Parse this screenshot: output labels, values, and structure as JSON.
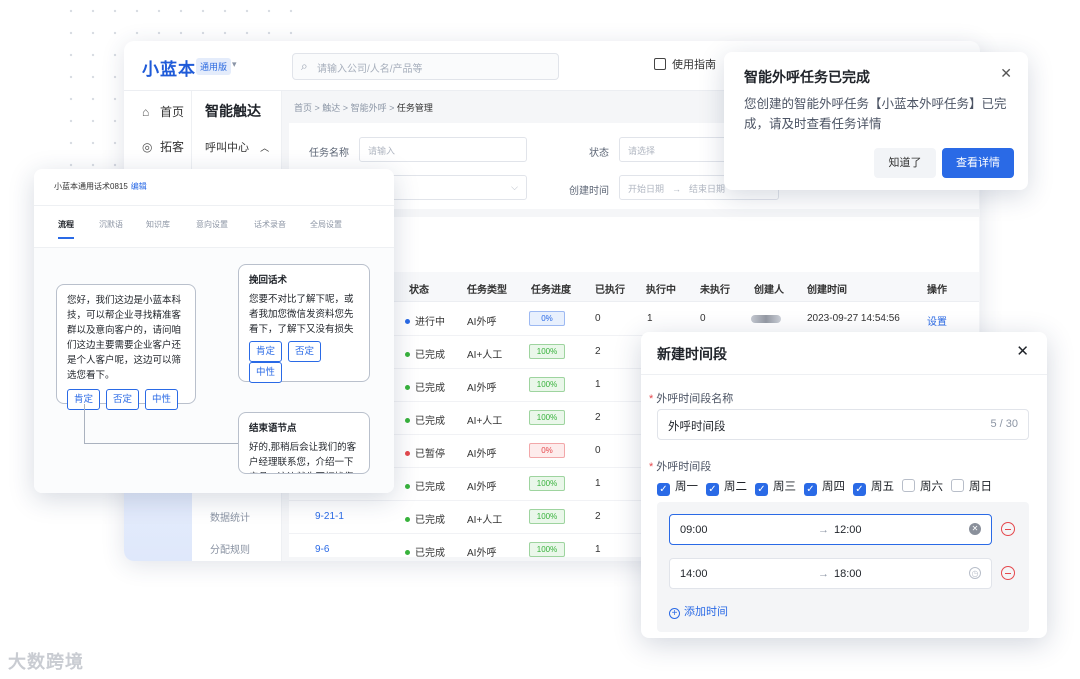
{
  "app": {
    "logo": "小蓝本",
    "edition": "通用版",
    "search_placeholder": "请输入公司/人名/产品等",
    "guide": "使用指南",
    "nav": {
      "home": "首页",
      "prospect": "拓客"
    },
    "subnav": {
      "title": "智能触达",
      "group": "呼叫中心",
      "lower1": "数据统计",
      "lower2": "分配规则"
    },
    "breadcrumb": [
      "首页",
      "触达",
      "智能外呼",
      "任务管理"
    ],
    "filters": {
      "task_name_label": "任务名称",
      "task_name_placeholder": "请输入",
      "status_label": "状态",
      "status_placeholder": "请选择",
      "created_label": "创建时间",
      "start_placeholder": "开始日期",
      "end_placeholder": "结束日期"
    },
    "table": {
      "headers": [
        "状态",
        "任务类型",
        "任务进度",
        "已执行",
        "执行中",
        "未执行",
        "创建人",
        "创建时间",
        "操作"
      ],
      "rows": [
        {
          "status": "进行中",
          "status_color": "#2a6ae6",
          "type": "AI外呼",
          "progress": "0%",
          "progress_kind": "blue",
          "done": "0",
          "running": "1",
          "pending": "0",
          "created": "2023-09-27 14:54:56",
          "action": "设置"
        },
        {
          "status": "已完成",
          "status_color": "#38b23c",
          "type": "AI+人工",
          "progress": "100%",
          "progress_kind": "green",
          "done": "2"
        },
        {
          "status": "已完成",
          "status_color": "#38b23c",
          "type": "AI外呼",
          "progress": "100%",
          "progress_kind": "green",
          "done": "1"
        },
        {
          "status": "已完成",
          "status_color": "#38b23c",
          "type": "AI+人工",
          "progress": "100%",
          "progress_kind": "green",
          "done": "2"
        },
        {
          "status": "已暂停",
          "status_color": "#e5484d",
          "type": "AI外呼",
          "progress": "0%",
          "progress_kind": "red",
          "done": "0"
        },
        {
          "status": "已完成",
          "status_color": "#38b23c",
          "type": "AI外呼",
          "progress": "100%",
          "progress_kind": "green",
          "done": "1"
        },
        {
          "status": "已完成",
          "status_color": "#38b23c",
          "type": "AI+人工",
          "progress": "100%",
          "progress_kind": "green",
          "done": "2",
          "name": "9-21-1"
        },
        {
          "status": "已完成",
          "status_color": "#38b23c",
          "type": "AI外呼",
          "progress": "100%",
          "progress_kind": "green",
          "done": "1",
          "name": "9-6"
        }
      ]
    }
  },
  "script_editor": {
    "title": "小蓝本通用话术0815",
    "edit": "编辑",
    "tabs": [
      "流程",
      "沉默语",
      "知识库",
      "意向设置",
      "话术录音",
      "全局设置"
    ],
    "node_main": "您好，我们这边是小蓝本科技，可以帮企业寻找精准客群以及意向客户的，请问咱们这边主要需要企业客户还是个人客户呢，这边可以筛选您看下。",
    "node_recover_title": "挽回话术",
    "node_recover_text": "您要不对比了解下呢，或者我加您微信发资料您先看下，了解下又没有损失的嘛",
    "node_end_title": "结束语节点",
    "node_end_text": "好的,那稍后会让我们的客户经理联系您，介绍一下产品，这边就先不打扰您了",
    "chips": [
      "肯定",
      "否定",
      "中性"
    ]
  },
  "notification": {
    "title": "智能外呼任务已完成",
    "message": "您创建的智能外呼任务【小蓝本外呼任务】已完成，请及时查看任务详情",
    "dismiss": "知道了",
    "view": "查看详情"
  },
  "dialog": {
    "title": "新建时间段",
    "name_label": "外呼时间段名称",
    "name_value": "外呼时间段",
    "name_count": "5 / 30",
    "period_label": "外呼时间段",
    "days": [
      {
        "label": "周一",
        "checked": true
      },
      {
        "label": "周二",
        "checked": true
      },
      {
        "label": "周三",
        "checked": true
      },
      {
        "label": "周四",
        "checked": true
      },
      {
        "label": "周五",
        "checked": true
      },
      {
        "label": "周六",
        "checked": false
      },
      {
        "label": "周日",
        "checked": false
      }
    ],
    "ranges": [
      {
        "start": "09:00",
        "end": "12:00"
      },
      {
        "start": "14:00",
        "end": "18:00"
      }
    ],
    "arrow": "→",
    "add_time": "添加时间"
  },
  "watermark": "大数跨境"
}
